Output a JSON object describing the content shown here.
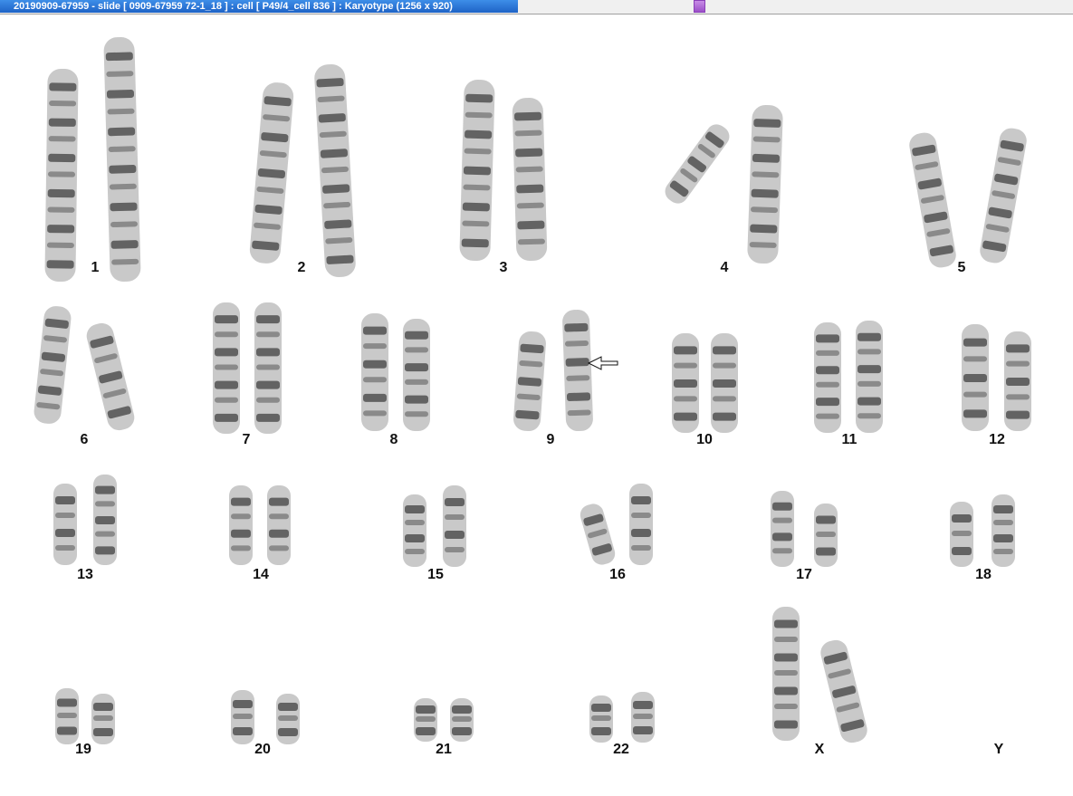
{
  "window": {
    "title": "20190909-67959 - slide [ 0909-67959 72-1_18 ] : cell [ P49/4_cell 836 ] : Karyotype  (1256 x 920)"
  },
  "colors": {
    "title_bar": "#2a74d8",
    "chromosome_dark": "#2a2a2a",
    "chromosome_light": "#d8d8d8"
  },
  "karyotype": {
    "chromosomes": [
      {
        "id": "1",
        "label": "1"
      },
      {
        "id": "2",
        "label": "2"
      },
      {
        "id": "3",
        "label": "3"
      },
      {
        "id": "4",
        "label": "4"
      },
      {
        "id": "5",
        "label": "5"
      },
      {
        "id": "6",
        "label": "6"
      },
      {
        "id": "7",
        "label": "7"
      },
      {
        "id": "8",
        "label": "8"
      },
      {
        "id": "9",
        "label": "9",
        "marker": "arrow-icon"
      },
      {
        "id": "10",
        "label": "10"
      },
      {
        "id": "11",
        "label": "11"
      },
      {
        "id": "12",
        "label": "12"
      },
      {
        "id": "13",
        "label": "13"
      },
      {
        "id": "14",
        "label": "14"
      },
      {
        "id": "15",
        "label": "15"
      },
      {
        "id": "16",
        "label": "16"
      },
      {
        "id": "17",
        "label": "17"
      },
      {
        "id": "18",
        "label": "18"
      },
      {
        "id": "19",
        "label": "19"
      },
      {
        "id": "20",
        "label": "20"
      },
      {
        "id": "21",
        "label": "21"
      },
      {
        "id": "22",
        "label": "22"
      },
      {
        "id": "X",
        "label": "X"
      },
      {
        "id": "Y",
        "label": "Y"
      }
    ]
  }
}
